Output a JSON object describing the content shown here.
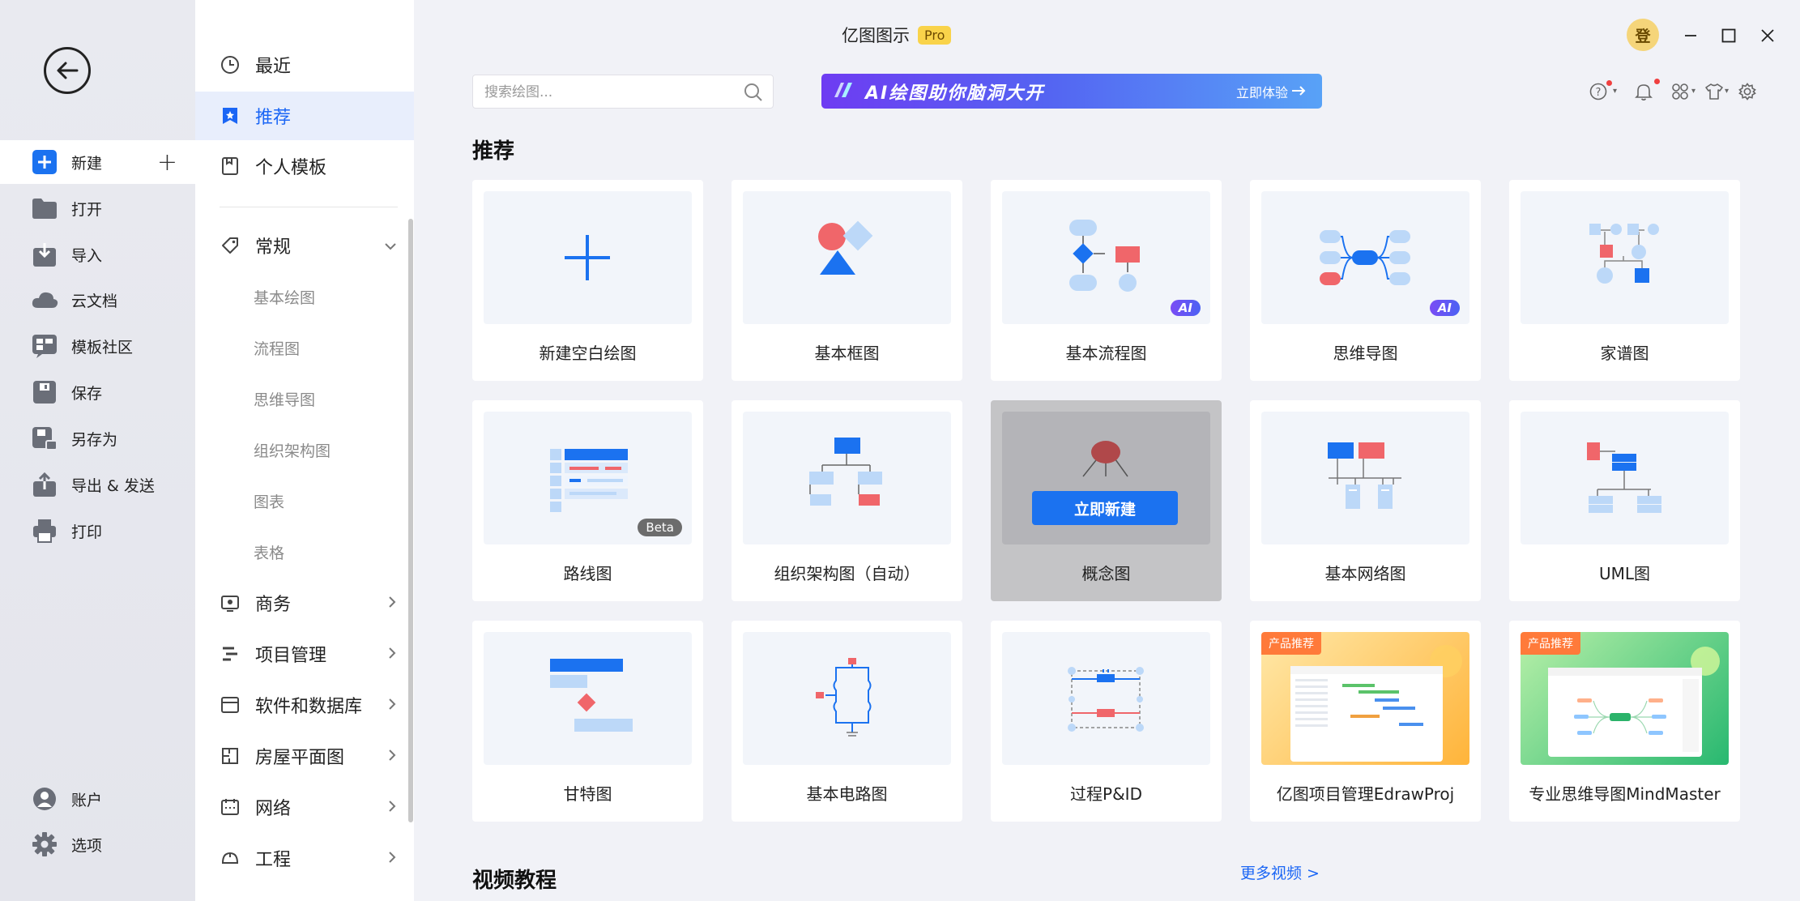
{
  "app": {
    "title": "亿图图示",
    "badge": "Pro"
  },
  "rail": {
    "items": [
      {
        "label": "新建",
        "icon": "new-file-icon"
      },
      {
        "label": "打开",
        "icon": "folder-icon"
      },
      {
        "label": "导入",
        "icon": "import-icon"
      },
      {
        "label": "云文档",
        "icon": "cloud-icon"
      },
      {
        "label": "模板社区",
        "icon": "template-community-icon"
      },
      {
        "label": "保存",
        "icon": "save-icon"
      },
      {
        "label": "另存为",
        "icon": "save-as-icon"
      },
      {
        "label": "导出 & 发送",
        "icon": "export-icon"
      },
      {
        "label": "打印",
        "icon": "print-icon"
      },
      {
        "label": "账户",
        "icon": "account-icon"
      },
      {
        "label": "选项",
        "icon": "gear-icon"
      }
    ]
  },
  "categories": {
    "top": [
      {
        "label": "最近",
        "icon": "clock-icon"
      },
      {
        "label": "推荐",
        "icon": "bookmark-star-icon"
      },
      {
        "label": "个人模板",
        "icon": "personal-template-icon"
      }
    ],
    "general": {
      "label": "常规",
      "icon": "tag-icon"
    },
    "general_sub": [
      "基本绘图",
      "流程图",
      "思维导图",
      "组织架构图",
      "图表",
      "表格"
    ],
    "groups": [
      {
        "label": "商务",
        "icon": "business-icon"
      },
      {
        "label": "项目管理",
        "icon": "project-icon"
      },
      {
        "label": "软件和数据库",
        "icon": "software-icon"
      },
      {
        "label": "房屋平面图",
        "icon": "floorplan-icon"
      },
      {
        "label": "网络",
        "icon": "network-icon"
      },
      {
        "label": "工程",
        "icon": "helmet-icon"
      }
    ]
  },
  "search": {
    "placeholder": "搜索绘图..."
  },
  "ai_banner": {
    "text": "AI绘图助你脑洞大开",
    "cta": "立即体验"
  },
  "avatar_text": "登",
  "section_recommend": "推荐",
  "section_videos": "视频教程",
  "more_videos": "更多视频 >",
  "cards": [
    {
      "label": "新建空白绘图"
    },
    {
      "label": "基本框图"
    },
    {
      "label": "基本流程图",
      "tag": "AI"
    },
    {
      "label": "思维导图",
      "tag": "AI"
    },
    {
      "label": "家谱图"
    },
    {
      "label": "路线图",
      "tag": "Beta"
    },
    {
      "label": "组织架构图（自动）"
    },
    {
      "label": "概念图",
      "hover_button": "立即新建"
    },
    {
      "label": "基本网络图"
    },
    {
      "label": "UML图"
    },
    {
      "label": "甘特图"
    },
    {
      "label": "基本电路图"
    },
    {
      "label": "过程P&ID"
    },
    {
      "label": "亿图项目管理EdrawProj",
      "promo": "产品推荐"
    },
    {
      "label": "专业思维导图MindMaster",
      "promo": "产品推荐"
    }
  ],
  "colors": {
    "accent": "#1b66f5",
    "active_bg": "#e8eefc",
    "promo": "#ff7a3a"
  }
}
